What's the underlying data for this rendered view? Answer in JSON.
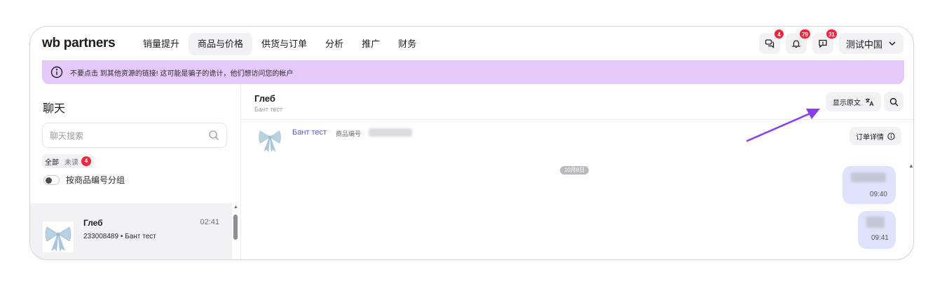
{
  "logo": {
    "part1": "wb",
    "part2": "partners"
  },
  "nav": [
    {
      "label": "销量提升"
    },
    {
      "label": "商品与价格"
    },
    {
      "label": "供货与订单"
    },
    {
      "label": "分析"
    },
    {
      "label": "推广"
    },
    {
      "label": "财务"
    }
  ],
  "header": {
    "chat_badge": "4",
    "notif_badge": "79",
    "feedback_badge": "31",
    "account_label": "测试中国"
  },
  "warning": {
    "text": "不要点击 到其他资源的链接! 这可能是骗子的诡计，他们想访问您的帐户"
  },
  "sidebar": {
    "title": "聊天",
    "search_placeholder": "聊天搜索",
    "filter_all": "全部",
    "filter_unread": "未读",
    "unread_count": "4",
    "group_toggle_label": "按商品编号分组",
    "chats": [
      {
        "name": "Глеб",
        "time": "02:41",
        "article": "233008489",
        "product": "Бант тест"
      }
    ]
  },
  "conversation": {
    "name": "Глеб",
    "subtitle": "Бант тест",
    "show_original_label": "显示原文",
    "product_name": "Бант тест",
    "product_code_label": "商品编号",
    "order_details_label": "订单详情",
    "date_label": "10月8日",
    "messages": [
      {
        "time": "09:40"
      },
      {
        "time": "09:41"
      }
    ]
  },
  "colors": {
    "accent": "#8b21c9",
    "badge": "#f5273e",
    "warning_bg": "#e6c9fb",
    "bubble": "#dde3fb",
    "link": "#4a63c9",
    "arrow": "#8a3cf0"
  }
}
